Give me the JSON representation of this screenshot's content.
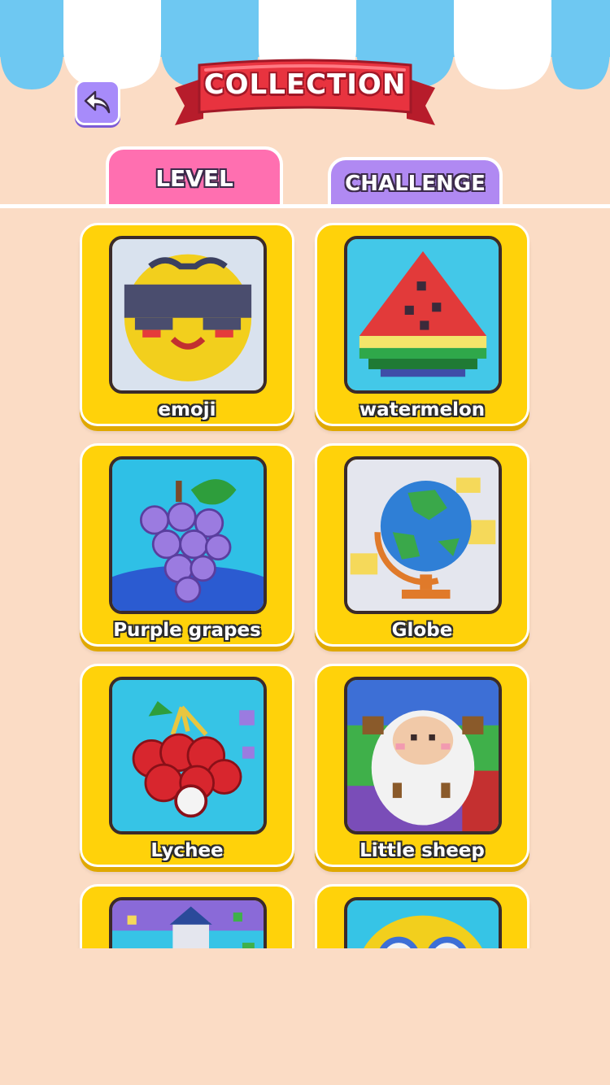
{
  "header": {
    "title": "COLLECTION",
    "back_icon": "back-arrow-icon"
  },
  "tabs": [
    {
      "label": "LEVEL",
      "selected": true,
      "color": "#ff6fb0"
    },
    {
      "label": "CHALLENGE",
      "selected": false,
      "color": "#b089f2"
    }
  ],
  "items": [
    {
      "label": "emoji",
      "art": "emoji-pixel-art"
    },
    {
      "label": "watermelon",
      "art": "watermelon-pixel-art"
    },
    {
      "label": "Purple grapes",
      "art": "grapes-pixel-art"
    },
    {
      "label": "Globe",
      "art": "globe-pixel-art"
    },
    {
      "label": "Lychee",
      "art": "lychee-pixel-art"
    },
    {
      "label": "Little sheep",
      "art": "sheep-pixel-art"
    },
    {
      "label": "",
      "art": "house-pixel-art"
    },
    {
      "label": "",
      "art": "owl-pixel-art"
    }
  ],
  "colors": {
    "background": "#fbdcc5",
    "card": "#ffd20a",
    "awning_blue": "#6ec8f2",
    "banner_red": "#e8333f"
  }
}
